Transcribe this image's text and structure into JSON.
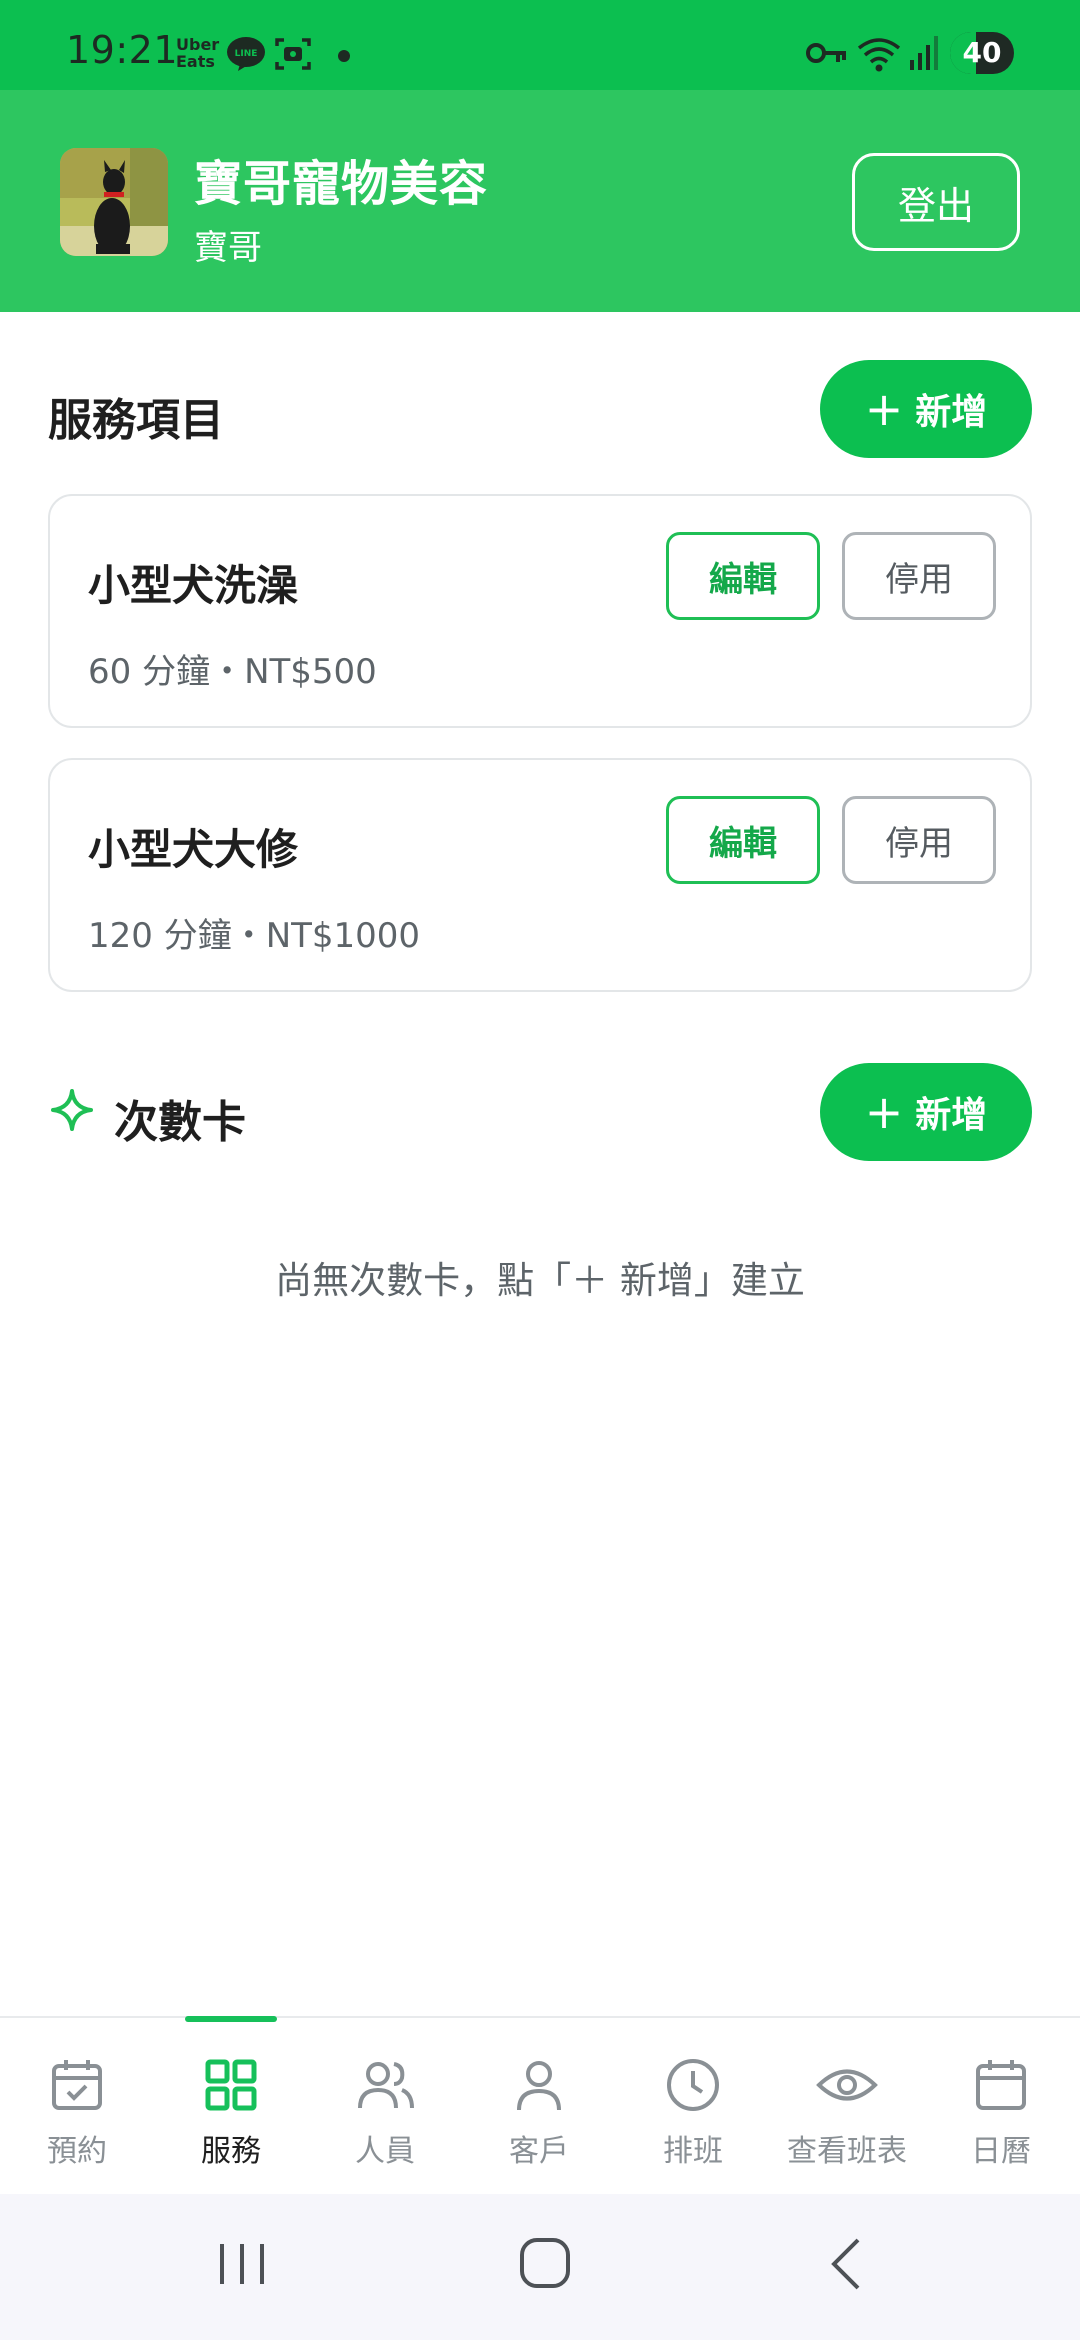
{
  "status_bar": {
    "time": "19:21",
    "app_notification_line1": "Uber",
    "app_notification_line2": "Eats",
    "battery_level": "40",
    "battery_fraction": 0.4,
    "icons": [
      "line-icon",
      "screenshot-icon",
      "key-icon",
      "wifi-icon",
      "signal-icon",
      "battery-icon"
    ]
  },
  "header": {
    "shop_name": "寶哥寵物美容",
    "owner_name": "寶哥",
    "logout_label": "登出"
  },
  "services": {
    "title": "服務項目",
    "add_label": "新增",
    "items": [
      {
        "name": "小型犬洗澡",
        "meta": "60 分鐘・NT$500",
        "edit_label": "編輯",
        "disable_label": "停用"
      },
      {
        "name": "小型犬大修",
        "meta": "120 分鐘・NT$1000",
        "edit_label": "編輯",
        "disable_label": "停用"
      }
    ]
  },
  "punch_cards": {
    "title": "次數卡",
    "add_label": "新增",
    "empty_message": "尚無次數卡，點「＋ 新增」建立"
  },
  "bottom_nav": {
    "active": "服務",
    "items": [
      {
        "label": "預約",
        "icon": "calendar-check-icon"
      },
      {
        "label": "服務",
        "icon": "grid-icon"
      },
      {
        "label": "人員",
        "icon": "users-icon"
      },
      {
        "label": "客戶",
        "icon": "user-icon"
      },
      {
        "label": "排班",
        "icon": "clock-icon"
      },
      {
        "label": "查看班表",
        "icon": "eye-icon"
      },
      {
        "label": "日曆",
        "icon": "calendar-icon"
      }
    ]
  },
  "colors": {
    "primary": "#0cbf50",
    "header": "#2dc660",
    "text": "#1f1f1f",
    "muted": "#5d6469"
  }
}
